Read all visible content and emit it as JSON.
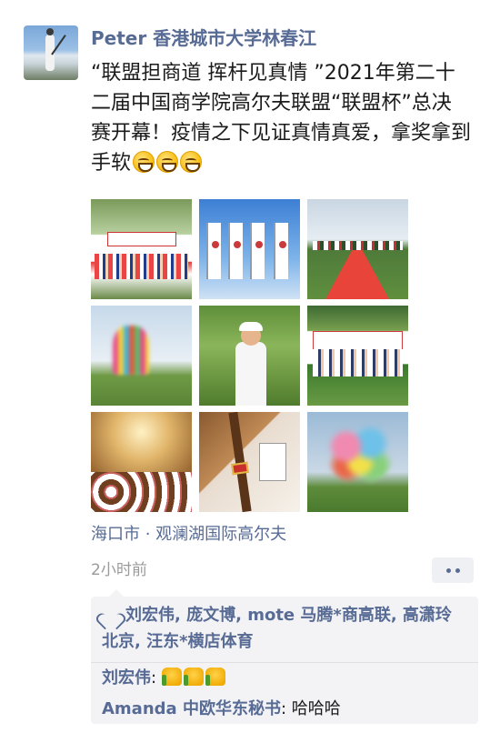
{
  "post": {
    "username": "Peter 香港城市大学林春江",
    "text": "“联盟担商道 挥杆见真情 ”2021年第二十二届中国商学院高尔夫联盟“联盟杯”总决赛开幕！疫情之下见证真情真爱，拿奖拿到手软",
    "emoji": [
      "grinning-face-icon",
      "grinning-face-icon",
      "grinning-face-icon"
    ],
    "photos": [
      "ceremony-group-photo",
      "flags-photo",
      "red-carpet-photo",
      "colored-smoke-photo",
      "golfer-swing-photo",
      "banner-group-photo",
      "banquet-hall-photo",
      "cigar-wine-photo",
      "smoke-cloud-photo"
    ],
    "location": "海口市 · 观澜湖国际高尔夫",
    "time": "2小时前"
  },
  "likes": {
    "icon": "heart-icon",
    "names": "刘宏伟, 庞文博, mote 马腾*商高联, 高潇玲北京, 汪东*横店体育"
  },
  "comments": [
    {
      "author": "刘宏伟",
      "separator": ": ",
      "text": "",
      "reaction": [
        "thumbs-up-icon",
        "thumbs-up-icon",
        "thumbs-up-icon"
      ]
    },
    {
      "author": "Amanda 中欧华东秘书",
      "separator": ": ",
      "text": "哈哈哈"
    }
  ],
  "colors": {
    "link": "#576b95",
    "time": "#9a9a9a",
    "panel": "#f3f3f5"
  }
}
